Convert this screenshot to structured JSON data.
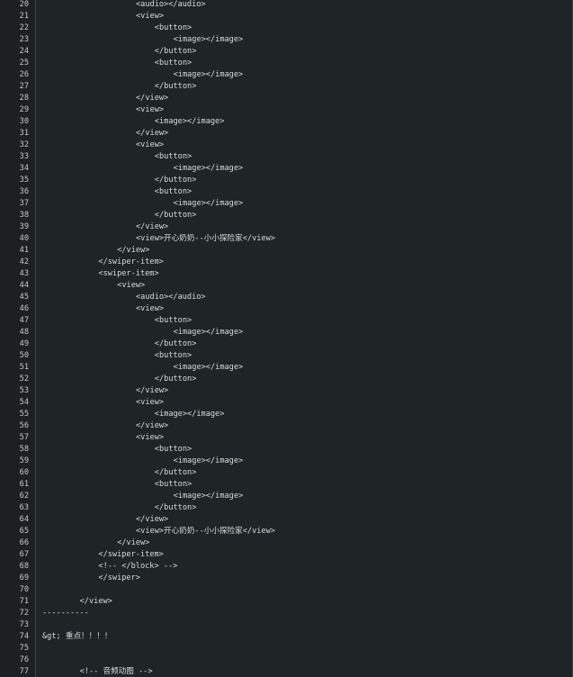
{
  "editor": {
    "lines": [
      {
        "n": "20",
        "indent": 5,
        "text": "<audio></audio>"
      },
      {
        "n": "21",
        "indent": 5,
        "text": "<view>"
      },
      {
        "n": "22",
        "indent": 6,
        "text": "<button>"
      },
      {
        "n": "23",
        "indent": 7,
        "text": "<image></image>"
      },
      {
        "n": "24",
        "indent": 6,
        "text": "</button>"
      },
      {
        "n": "25",
        "indent": 6,
        "text": "<button>"
      },
      {
        "n": "26",
        "indent": 7,
        "text": "<image></image>"
      },
      {
        "n": "27",
        "indent": 6,
        "text": "</button>"
      },
      {
        "n": "28",
        "indent": 5,
        "text": "</view>"
      },
      {
        "n": "29",
        "indent": 5,
        "text": "<view>"
      },
      {
        "n": "30",
        "indent": 6,
        "text": "<image></image>"
      },
      {
        "n": "31",
        "indent": 5,
        "text": "</view>"
      },
      {
        "n": "32",
        "indent": 5,
        "text": "<view>"
      },
      {
        "n": "33",
        "indent": 6,
        "text": "<button>"
      },
      {
        "n": "34",
        "indent": 7,
        "text": "<image></image>"
      },
      {
        "n": "35",
        "indent": 6,
        "text": "</button>"
      },
      {
        "n": "36",
        "indent": 6,
        "text": "<button>"
      },
      {
        "n": "37",
        "indent": 7,
        "text": "<image></image>"
      },
      {
        "n": "38",
        "indent": 6,
        "text": "</button>"
      },
      {
        "n": "39",
        "indent": 5,
        "text": "</view>"
      },
      {
        "n": "40",
        "indent": 5,
        "text": "<view>开心奶奶--小小探险家</view>"
      },
      {
        "n": "41",
        "indent": 4,
        "text": "</view>"
      },
      {
        "n": "42",
        "indent": 3,
        "text": "</swiper-item>"
      },
      {
        "n": "43",
        "indent": 3,
        "text": "<swiper-item>"
      },
      {
        "n": "44",
        "indent": 4,
        "text": "<view>"
      },
      {
        "n": "45",
        "indent": 5,
        "text": "<audio></audio>"
      },
      {
        "n": "46",
        "indent": 5,
        "text": "<view>"
      },
      {
        "n": "47",
        "indent": 6,
        "text": "<button>"
      },
      {
        "n": "48",
        "indent": 7,
        "text": "<image></image>"
      },
      {
        "n": "49",
        "indent": 6,
        "text": "</button>"
      },
      {
        "n": "50",
        "indent": 6,
        "text": "<button>"
      },
      {
        "n": "51",
        "indent": 7,
        "text": "<image></image>"
      },
      {
        "n": "52",
        "indent": 6,
        "text": "</button>"
      },
      {
        "n": "53",
        "indent": 5,
        "text": "</view>"
      },
      {
        "n": "54",
        "indent": 5,
        "text": "<view>"
      },
      {
        "n": "55",
        "indent": 6,
        "text": "<image></image>"
      },
      {
        "n": "56",
        "indent": 5,
        "text": "</view>"
      },
      {
        "n": "57",
        "indent": 5,
        "text": "<view>"
      },
      {
        "n": "58",
        "indent": 6,
        "text": "<button>"
      },
      {
        "n": "59",
        "indent": 7,
        "text": "<image></image>"
      },
      {
        "n": "60",
        "indent": 6,
        "text": "</button>"
      },
      {
        "n": "61",
        "indent": 6,
        "text": "<button>"
      },
      {
        "n": "62",
        "indent": 7,
        "text": "<image></image>"
      },
      {
        "n": "63",
        "indent": 6,
        "text": "</button>"
      },
      {
        "n": "64",
        "indent": 5,
        "text": "</view>"
      },
      {
        "n": "65",
        "indent": 5,
        "text": "<view>开心奶奶--小小探险家</view>"
      },
      {
        "n": "66",
        "indent": 4,
        "text": "</view>"
      },
      {
        "n": "67",
        "indent": 3,
        "text": "</swiper-item>"
      },
      {
        "n": "68",
        "indent": 3,
        "text": "<!-- </block> -->"
      },
      {
        "n": "69",
        "indent": 3,
        "text": "</swiper>"
      },
      {
        "n": "70",
        "indent": 0,
        "text": ""
      },
      {
        "n": "71",
        "indent": 2,
        "text": "</view>"
      },
      {
        "n": "72",
        "indent": 0,
        "text": "----------"
      },
      {
        "n": "73",
        "indent": 0,
        "text": ""
      },
      {
        "n": "74",
        "indent": 0,
        "text": "&gt; 重点！！！！"
      },
      {
        "n": "75",
        "indent": 0,
        "text": ""
      },
      {
        "n": "76",
        "indent": 0,
        "text": ""
      },
      {
        "n": "77",
        "indent": 2,
        "text": "<!-- 音频动图 -->"
      }
    ]
  }
}
